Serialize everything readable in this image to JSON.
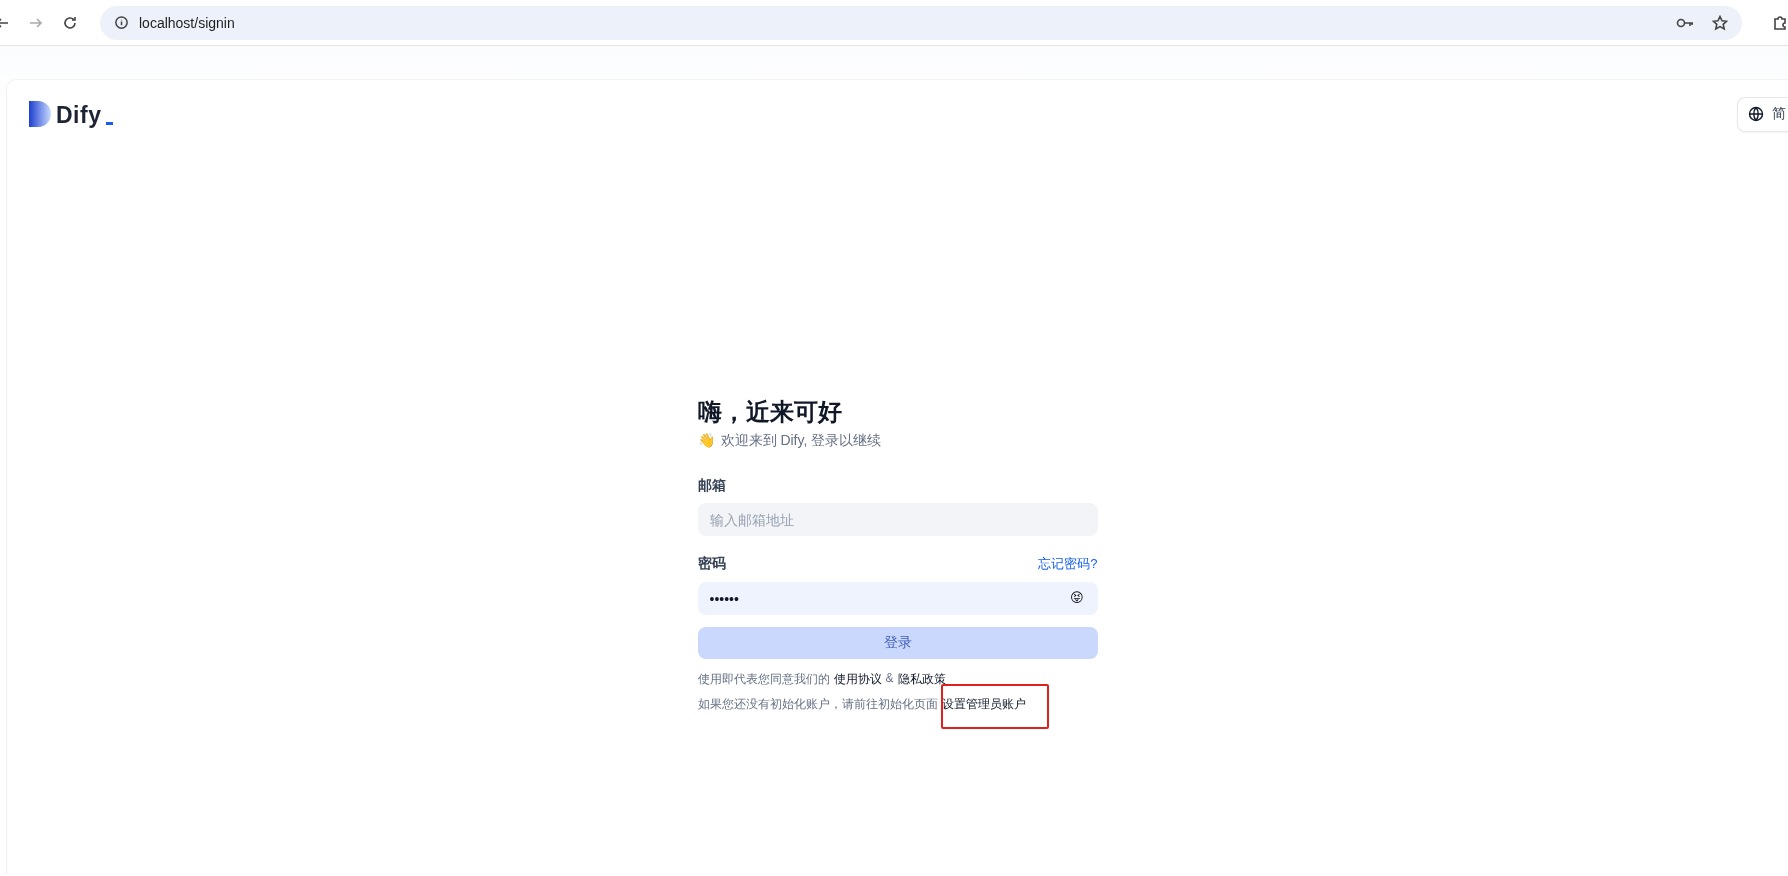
{
  "browser": {
    "url": "localhost/signin"
  },
  "header": {
    "logo_text": "Dify",
    "language": "简"
  },
  "signin": {
    "title": "嗨，近来可好",
    "wave": "👋",
    "subtitle": "欢迎来到 Dify, 登录以继续",
    "email_label": "邮箱",
    "email_placeholder": "输入邮箱地址",
    "password_label": "密码",
    "forgot_link": "忘记密码?",
    "password_value": "••••••",
    "eye_emoji": "😝",
    "submit": "登录",
    "submit_disabled": true,
    "terms_text": "使用即代表您同意我们的",
    "terms_link": "使用协议",
    "amp": "&",
    "privacy_link": "隐私政策",
    "init_text": "如果您还没有初始化账户，请前往初始化页面",
    "init_link": "设置管理员账户",
    "init_link_highlighted": true
  }
}
